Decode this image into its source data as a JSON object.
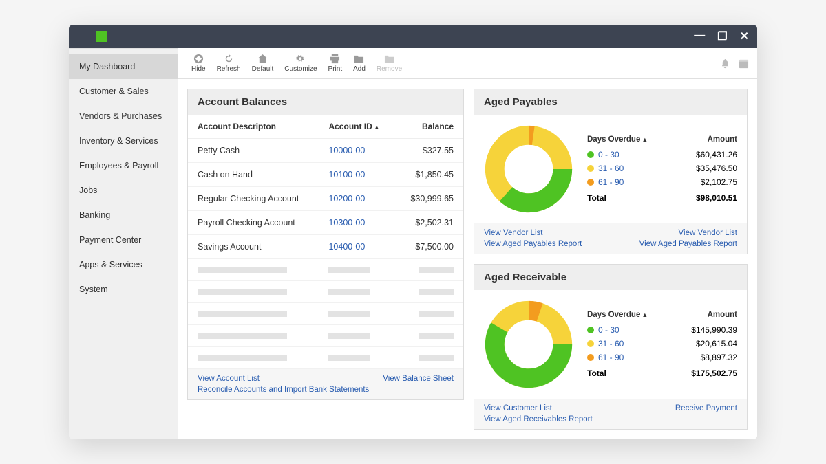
{
  "titlebar": {
    "min": "—",
    "max": "❐",
    "close": "✕"
  },
  "toolbar": {
    "hide": "Hide",
    "refresh": "Refresh",
    "default": "Default",
    "customize": "Customize",
    "print": "Print",
    "add": "Add",
    "remove": "Remove"
  },
  "sidebar": {
    "items": [
      "My Dashboard",
      "Customer & Sales",
      "Vendors & Purchases",
      "Inventory & Services",
      "Employees & Payroll",
      "Jobs",
      "Banking",
      "Payment Center",
      "Apps & Services",
      "System"
    ]
  },
  "balances": {
    "title": "Account Balances",
    "col_desc": "Account Descripton",
    "col_id": "Account ID",
    "col_bal": "Balance",
    "rows": [
      {
        "desc": "Petty Cash",
        "id": "10000-00",
        "bal": "$327.55"
      },
      {
        "desc": "Cash on Hand",
        "id": "10100-00",
        "bal": "$1,850.45"
      },
      {
        "desc": "Regular Checking Account",
        "id": "10200-00",
        "bal": "$30,999.65"
      },
      {
        "desc": "Payroll Checking Account",
        "id": "10300-00",
        "bal": "$2,502.31"
      },
      {
        "desc": "Savings Account",
        "id": "10400-00",
        "bal": "$7,500.00"
      }
    ],
    "footer": {
      "view_list": "View Account List",
      "view_sheet": "View Balance Sheet",
      "reconcile": "Reconcile Accounts and Import Bank Statements"
    }
  },
  "payables": {
    "title": "Aged Payables",
    "col_days": "Days Overdue",
    "col_amt": "Amount",
    "rows": [
      {
        "range": "0 - 30",
        "amt": "$60,431.26",
        "color": "#4fc323"
      },
      {
        "range": "31 - 60",
        "amt": "$35,476.50",
        "color": "#f6d33a"
      },
      {
        "range": "61 - 90",
        "amt": "$2,102.75",
        "color": "#f39c1f"
      }
    ],
    "total_label": "Total",
    "total": "$98,010.51",
    "footer": {
      "l1a": "View Vendor List",
      "l1b": "View Vendor List",
      "l2a": "View Aged Payables Report",
      "l2b": "View Aged Payables Report"
    }
  },
  "receivable": {
    "title": "Aged Receivable",
    "col_days": "Days Overdue",
    "col_amt": "Amount",
    "rows": [
      {
        "range": "0 - 30",
        "amt": "$145,990.39",
        "color": "#4fc323"
      },
      {
        "range": "31 - 60",
        "amt": "$20,615.04",
        "color": "#f6d33a"
      },
      {
        "range": "61 - 90",
        "amt": "$8,897.32",
        "color": "#f39c1f"
      }
    ],
    "total_label": "Total",
    "total": "$175,502.75",
    "footer": {
      "l1a": "View Customer List",
      "l1b": "Receive Payment",
      "l2a": "View Aged Receivables Report"
    }
  },
  "chart_data": [
    {
      "type": "pie",
      "title": "Aged Payables",
      "categories": [
        "0 - 30",
        "31 - 60",
        "61 - 90"
      ],
      "values": [
        60431.26,
        35476.5,
        2102.75
      ],
      "colors": [
        "#4fc323",
        "#f6d33a",
        "#f39c1f"
      ]
    },
    {
      "type": "pie",
      "title": "Aged Receivable",
      "categories": [
        "0 - 30",
        "31 - 60",
        "61 - 90"
      ],
      "values": [
        145990.39,
        20615.04,
        8897.32
      ],
      "colors": [
        "#4fc323",
        "#f6d33a",
        "#f39c1f"
      ]
    }
  ]
}
